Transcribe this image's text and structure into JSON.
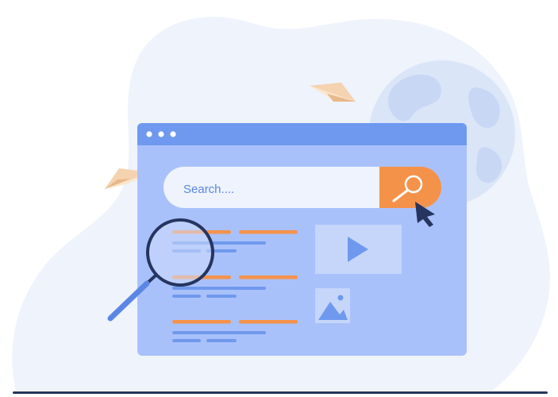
{
  "search": {
    "placeholder": "Search...."
  },
  "icons": {
    "window_dots": "three-dots-icon",
    "search_button": "magnifier-icon",
    "cursor": "arrow-cursor-icon",
    "video": "play-icon",
    "image": "image-icon",
    "magnifier": "magnifying-glass-icon",
    "globe": "globe-icon",
    "planes": "paper-plane-icon"
  },
  "colors": {
    "background_blob": "#eef3fc",
    "window_frame": "#a9c1fb",
    "window_titlebar": "#6f99ee",
    "search_bar": "#eef3fd",
    "search_button": "#f5924a",
    "result_orange": "#f5924a",
    "result_blue": "#6f99ee",
    "cursor": "#26355f",
    "globe": "#d3def5"
  }
}
